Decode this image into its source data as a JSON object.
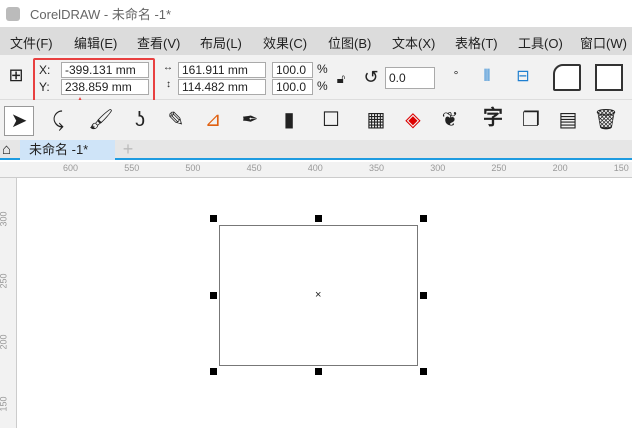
{
  "window": {
    "title": "CorelDRAW - 未命名 -1*"
  },
  "menu": [
    "文件(F)",
    "编辑(E)",
    "查看(V)",
    "布局(L)",
    "效果(C)",
    "位图(B)",
    "文本(X)",
    "表格(T)",
    "工具(O)",
    "窗口(W)"
  ],
  "propbar": {
    "x_label": "X:",
    "y_label": "Y:",
    "x_value": "-399.131 mm",
    "y_value": "238.859 mm",
    "width_value": "161.911 mm",
    "height_value": "114.482 mm",
    "scale_x": "100.0",
    "scale_y": "100.0",
    "percent": "%",
    "rotation": "0.0"
  },
  "toolbar": {
    "text_tool_glyph": "字"
  },
  "tabs": {
    "document": "未命名 -1*",
    "add": "+"
  },
  "ruler": {
    "h": [
      "600",
      "550",
      "500",
      "450",
      "400",
      "350",
      "300",
      "250",
      "200",
      "150"
    ],
    "v": [
      "300",
      "250",
      "200",
      "150"
    ]
  },
  "colors": {
    "highlight": "#e84040",
    "accent": "#1e9be0"
  }
}
